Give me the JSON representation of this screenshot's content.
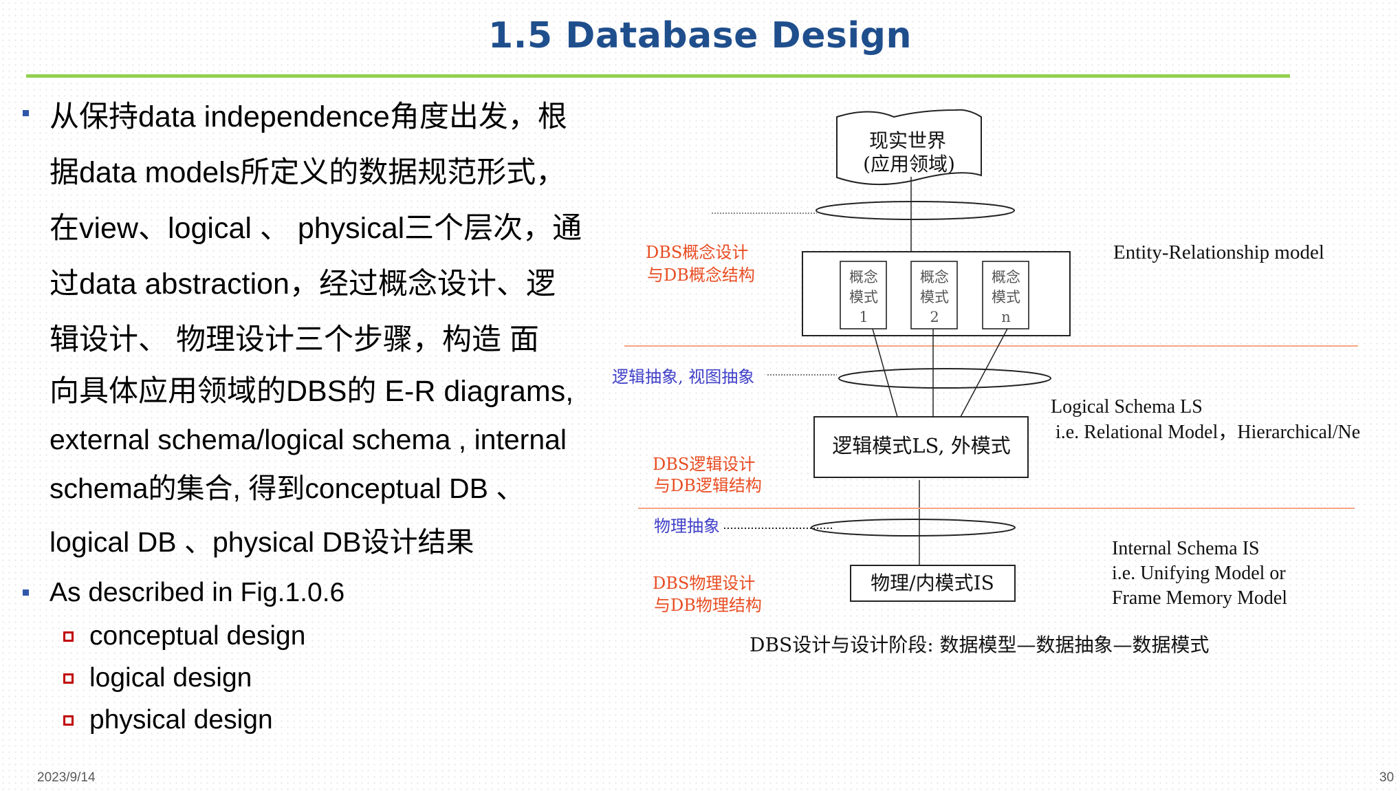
{
  "slide": {
    "title": "1.5 Database Design",
    "bullet1_lines": [
      "从保持data independence角度出发，根",
      "据data models所定义的数据规范形式，",
      "在view、logical 、 physical三个层次，通",
      "过data abstraction，经过概念设计、逻",
      "辑设计、 物理设计三个步骤，构造 面",
      "向具体应用领域的DBS的  E-R diagrams,",
      "external schema/logical schema , internal",
      "schema的集合, 得到conceptual DB 、",
      "logical DB 、physical DB设计结果"
    ],
    "bullet2": "As described in Fig.1.0.6",
    "sub_items": [
      "conceptual design",
      "logical design",
      "physical design"
    ],
    "footer_date": "2023/9/14",
    "page_number": "30"
  },
  "diagram": {
    "real_world": [
      "现实世界",
      "(应用领域)"
    ],
    "conceptual_boxes": [
      [
        "概念",
        "模式",
        "1"
      ],
      [
        "概念",
        "模式",
        "2"
      ],
      [
        "概念",
        "模式",
        "n"
      ]
    ],
    "conceptual_design_label": [
      "DBS概念设计",
      "与DB概念结构"
    ],
    "er_model_label": "Entity-Relationship model",
    "logical_abstraction_label": "逻辑抽象, 视图抽象",
    "logical_box": "逻辑模式LS, 外模式",
    "logical_schema_label": [
      "Logical Schema  LS",
      "i.e. Relational  Model，Hierarchical/Ne"
    ],
    "logical_design_label": [
      "DBS逻辑设计",
      "与DB逻辑结构"
    ],
    "physical_abstraction_label": "物理抽象",
    "physical_box": "物理/内模式IS",
    "internal_schema_label": [
      "Internal Schema  IS",
      "i.e. Unifying Model  or",
      "Frame Memory Model"
    ],
    "physical_design_label": [
      "DBS物理设计",
      "与DB物理结构"
    ],
    "caption": "DBS设计与设计阶段:  数据模型—数据抽象—数据模式"
  },
  "colors": {
    "title": "#1f4e8c",
    "rule": "#92d050",
    "bullet": "#2e57a8",
    "sub_bullet": "#c00000",
    "diagram_red": "#e84c22",
    "diagram_blue": "#4040c8",
    "separator": "#f4a582"
  }
}
